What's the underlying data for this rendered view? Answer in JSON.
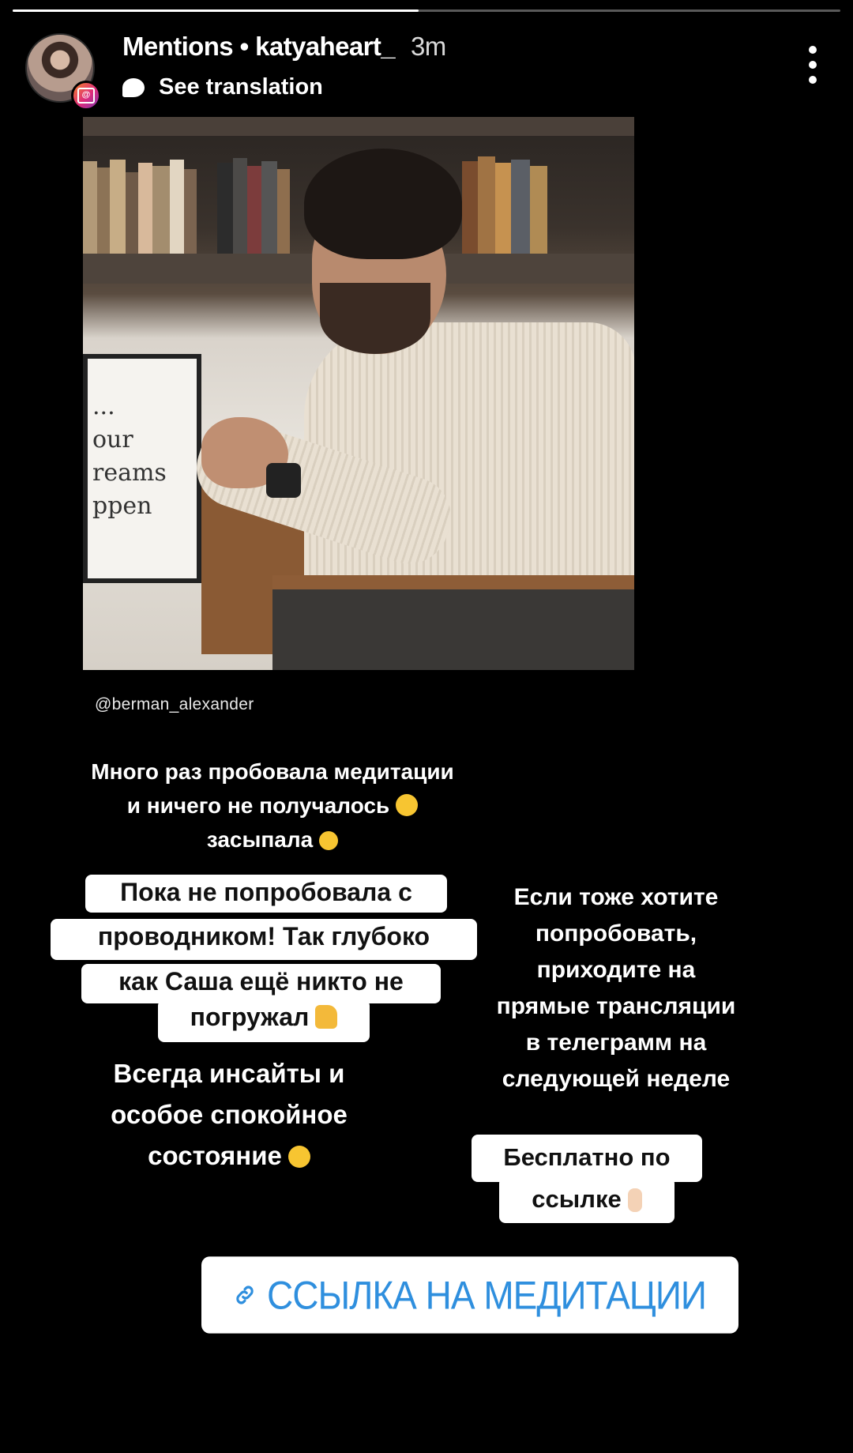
{
  "story": {
    "progress": 0.49
  },
  "header": {
    "title": "Mentions • katyaheart_",
    "time": "3m",
    "see_translation": "See translation",
    "menu_icon": "more-vertical-icon",
    "mention_badge_icon": "at-mention-icon"
  },
  "content": {
    "photo_handle": "@berman_alexander",
    "photo_frame_text": [
      "...",
      "our",
      "reams",
      "ppen"
    ],
    "text_1": [
      "Много раз пробовала медитации",
      "и ничего не получалось",
      "засыпала"
    ],
    "highlight_box": [
      "Пока не попробовала с",
      "проводником!  Так глубоко",
      "как Саша ещё никто не",
      "погружал"
    ],
    "text_2": [
      "Всегда инсайты и",
      "особое спокойное",
      "состояние"
    ],
    "text_3": [
      "Если тоже хотите",
      "попробовать,",
      "приходите на",
      "прямые трансляции",
      "в телеграмм на",
      "следующей неделе"
    ],
    "free_box": [
      "Бесплатно по",
      "ссылке"
    ],
    "link_sticker": "ССЫЛКА НА МЕДИТАЦИИ"
  },
  "colors": {
    "link_blue": "#2f8fde",
    "background": "#000000"
  }
}
